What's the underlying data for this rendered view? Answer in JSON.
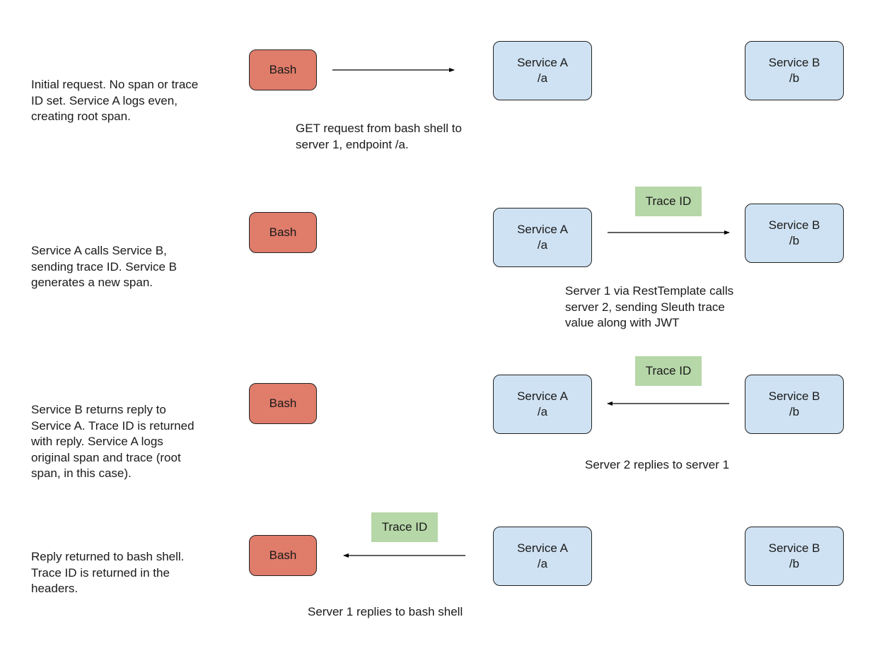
{
  "steps": [
    {
      "description": "Initial request. No span or trace\nID set. Service A logs even,\ncreating root span.",
      "bash": "Bash",
      "service_a": "Service A\n/a",
      "service_b": "Service B\n/b",
      "arrow": "bash-to-service-a",
      "caption": "GET request from bash shell to\nserver 1, endpoint /a."
    },
    {
      "description": "Service A calls Service B,\nsending trace ID. Service B\ngenerates a new span.",
      "bash": "Bash",
      "service_a": "Service A\n/a",
      "service_b": "Service B\n/b",
      "trace_label": "Trace ID",
      "arrow": "service-a-to-service-b",
      "caption": "Server 1 via RestTemplate calls\nserver 2, sending Sleuth trace\nvalue along with JWT"
    },
    {
      "description": "Service B returns reply to\nService A. Trace ID is returned\nwith reply. Service A logs\noriginal span and trace (root\nspan, in this case).",
      "bash": "Bash",
      "service_a": "Service A\n/a",
      "service_b": "Service B\n/b",
      "trace_label": "Trace ID",
      "arrow": "service-b-to-service-a",
      "caption": "Server 2 replies to server 1"
    },
    {
      "description": "Reply returned to bash shell.\nTrace ID is returned in the\nheaders.",
      "bash": "Bash",
      "service_a": "Service A\n/a",
      "service_b": "Service B\n/b",
      "trace_label": "Trace ID",
      "arrow": "service-a-to-bash",
      "caption": "Server 1 replies to bash shell"
    }
  ],
  "colors": {
    "bash": "#e07c6a",
    "service": "#cfe2f3",
    "trace": "#b6d7a8"
  }
}
